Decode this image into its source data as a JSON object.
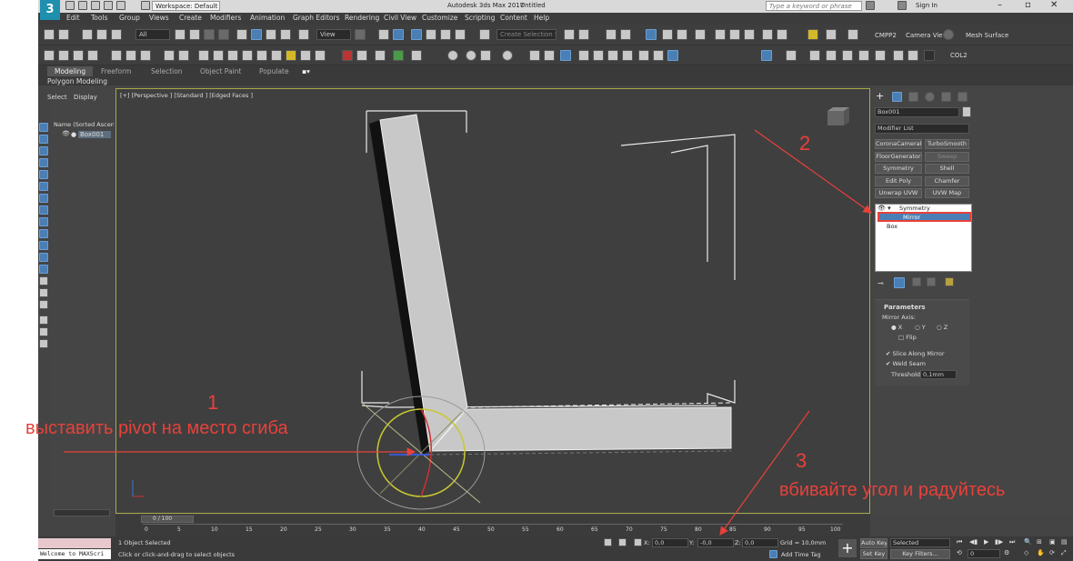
{
  "titlebar": {
    "workspace": "Workspace: Default",
    "app_title": "Autodesk 3ds Max 2017",
    "doc_title": "Untitled",
    "search_placeholder": "Type a keyword or phrase",
    "sign_in": "Sign In"
  },
  "menu": [
    "Edit",
    "Tools",
    "Group",
    "Views",
    "Create",
    "Modifiers",
    "Animation",
    "Graph Editors",
    "Rendering",
    "Civil View",
    "Customize",
    "Scripting",
    "Content",
    "Help"
  ],
  "toolbar1": {
    "filter": "All",
    "view": "View",
    "selection_set": "Create Selection Set",
    "cmpp2": "CMPP2",
    "camera_view": "Camera View",
    "mesh_surface": "Mesh Surface"
  },
  "toolbar2": {
    "axis_x": "X",
    "axis_y": "Y",
    "axis_z": "Z",
    "axis_xy": "XY",
    "col2": "COL2"
  },
  "ribbon": {
    "tabs": [
      "Modeling",
      "Freeform",
      "Selection",
      "Object Paint",
      "Populate"
    ],
    "sub": "Polygon Modeling"
  },
  "explorer": {
    "tab_select": "Select",
    "tab_display": "Display",
    "header": "Name (Sorted Ascending)",
    "item": "Box001",
    "scroll_label": "0 / 100"
  },
  "viewport": {
    "label": "[+] [Perspective ] [Standard ] [Edged Faces ]"
  },
  "panel": {
    "object_name": "Box001",
    "modifier_list": "Modifier List",
    "buttons": [
      "CoronaCameraMod",
      "TurboSmooth",
      "FloorGenerator",
      "Sweep",
      "Symmetry",
      "Shell",
      "Edit Poly",
      "Chamfer",
      "Unwrap UVW",
      "UVW Map"
    ],
    "stack": [
      "Symmetry",
      "Mirror",
      "Box"
    ],
    "params_title": "Parameters",
    "mirror_axis": "Mirror Axis:",
    "axis_x": "X",
    "axis_y": "Y",
    "axis_z": "Z",
    "flip": "Flip",
    "slice": "Slice Along Mirror",
    "weld": "Weld Seam",
    "threshold_label": "Threshold:",
    "threshold_value": "0,1mm"
  },
  "timeline": {
    "ticks": [
      "0",
      "5",
      "10",
      "15",
      "20",
      "25",
      "30",
      "35",
      "40",
      "45",
      "50",
      "55",
      "60",
      "65",
      "70",
      "75",
      "80",
      "85",
      "90",
      "95",
      "100"
    ]
  },
  "status": {
    "maxscript": "Welcome to MAXScri",
    "selected": "1 Object Selected",
    "hint": "Click or click-and-drag to select objects",
    "x_label": "X:",
    "x_value": "0,0",
    "y_label": "Y:",
    "y_value": "-0,0",
    "z_label": "Z:",
    "z_value": "0,0",
    "grid": "Grid = 10,0mm",
    "add_time_tag": "Add Time Tag",
    "auto_key": "Auto Key",
    "set_key": "Set Key",
    "selected_dd": "Selected",
    "key_filters": "Key Filters...",
    "frame": "0"
  },
  "annotations": {
    "n1": "1",
    "t1": "выставить pivot на место сгиба",
    "n2": "2",
    "n3": "3",
    "t3": "вбивайте угол и радуйтесь"
  },
  "colors": {
    "annotation": "#e8413a",
    "highlight": "#4a7fb5",
    "viewport_border": "#a8a84a"
  }
}
